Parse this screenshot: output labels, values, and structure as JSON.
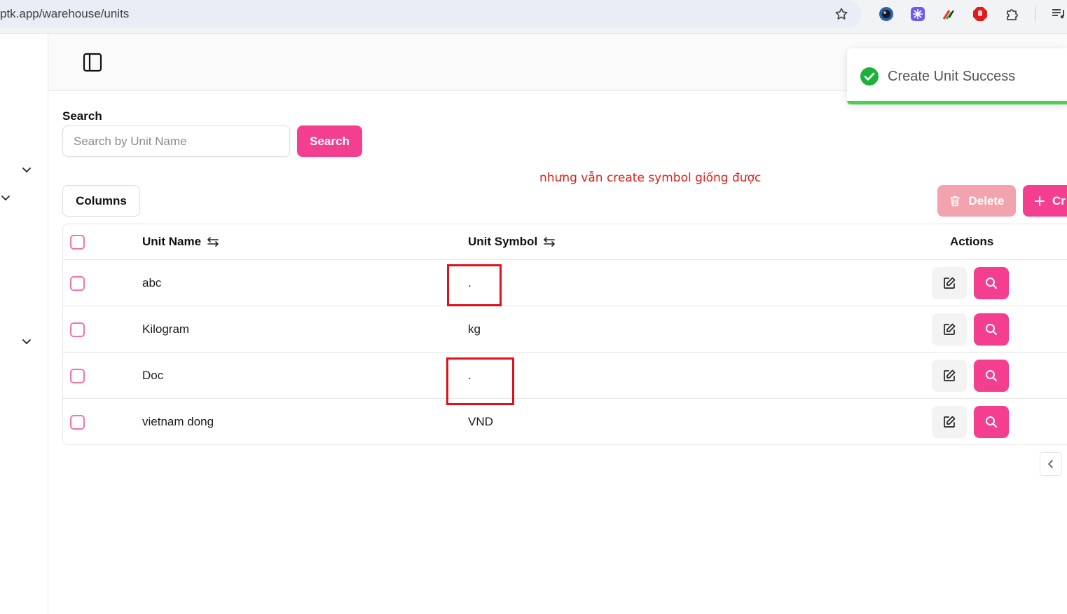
{
  "browser": {
    "url": "ptk.app/warehouse/units"
  },
  "search": {
    "label": "Search",
    "placeholder": "Search by Unit Name",
    "value": "",
    "button_label": "Search"
  },
  "annotation": {
    "text": "nhưng vẫn create symbol giống được",
    "color": "#e0201a"
  },
  "toolbar": {
    "columns_label": "Columns",
    "delete_label": "Delete",
    "create_label": "Cr"
  },
  "table": {
    "headers": {
      "unit_name": "Unit Name",
      "unit_symbol": "Unit Symbol",
      "actions": "Actions"
    },
    "rows": [
      {
        "unit_name": "abc",
        "unit_symbol": "."
      },
      {
        "unit_name": "Kilogram",
        "unit_symbol": "kg"
      },
      {
        "unit_name": "Doc",
        "unit_symbol": "."
      },
      {
        "unit_name": "vietnam dong",
        "unit_symbol": "VND"
      }
    ]
  },
  "toast": {
    "message": "Create Unit Success",
    "status": "success",
    "progress": 1.0
  },
  "colors": {
    "accent": "#f43f91",
    "delete_disabled": "#f2a3ad",
    "success": "#4cce4f",
    "highlight_box": "#e0101a"
  }
}
